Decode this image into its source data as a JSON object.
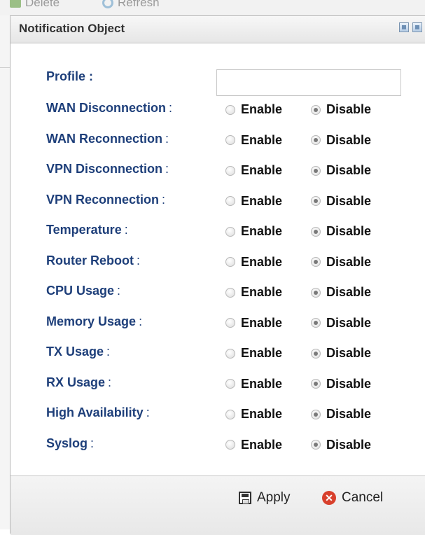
{
  "toolbar": {
    "delete_label": "Delete",
    "refresh_label": "Refresh"
  },
  "dialog": {
    "title": "Notification Object"
  },
  "form": {
    "profile_label": "Profile :",
    "profile_value": "",
    "enable_label": "Enable",
    "disable_label": "Disable",
    "rows": [
      {
        "label": "WAN Disconnection",
        "selected": "Disable"
      },
      {
        "label": "WAN Reconnection",
        "selected": "Disable"
      },
      {
        "label": "VPN Disconnection",
        "selected": "Disable"
      },
      {
        "label": "VPN Reconnection",
        "selected": "Disable"
      },
      {
        "label": "Temperature",
        "selected": "Disable"
      },
      {
        "label": "Router Reboot",
        "selected": "Disable"
      },
      {
        "label": "CPU Usage",
        "selected": "Disable"
      },
      {
        "label": "Memory Usage",
        "selected": "Disable"
      },
      {
        "label": "TX Usage",
        "selected": "Disable"
      },
      {
        "label": "RX Usage",
        "selected": "Disable"
      },
      {
        "label": "High Availability",
        "selected": "Disable"
      },
      {
        "label": "Syslog",
        "selected": "Disable"
      }
    ]
  },
  "footer": {
    "apply_label": "Apply",
    "cancel_label": "Cancel"
  },
  "icons": {
    "apply": "save-icon",
    "cancel": "cancel-icon",
    "delete": "delete-icon",
    "refresh": "refresh-icon"
  }
}
